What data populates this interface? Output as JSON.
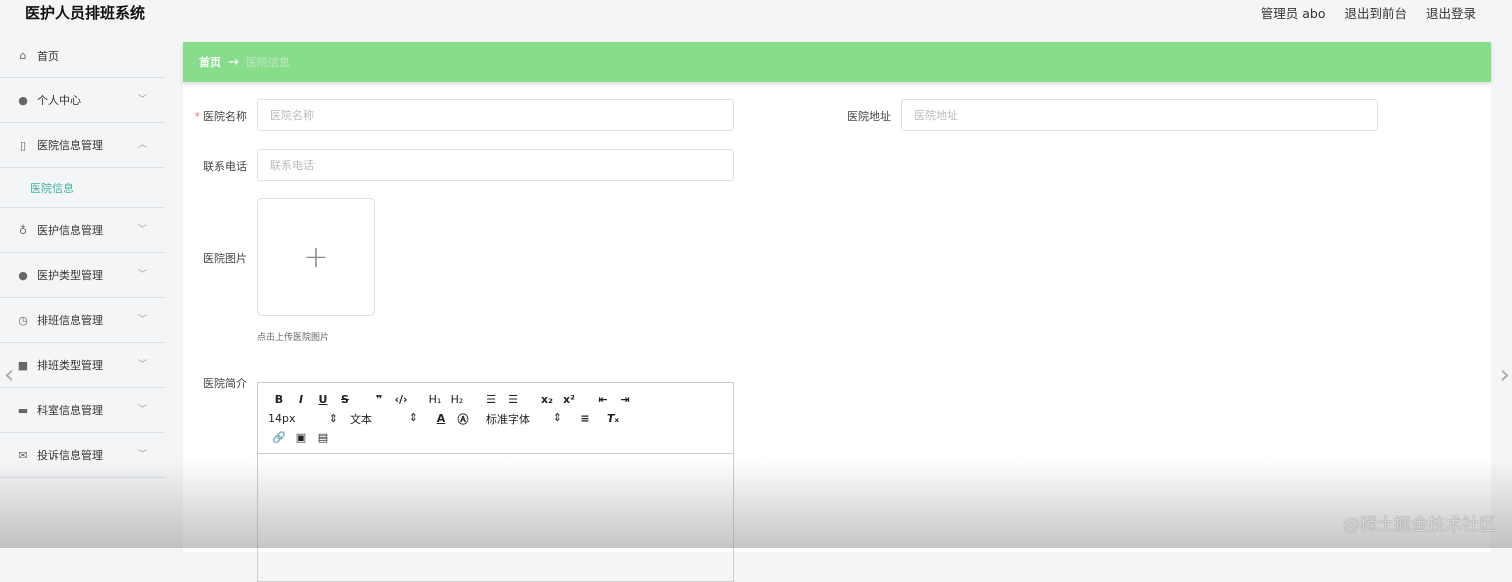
{
  "app": {
    "title": "医护人员排班系统"
  },
  "header": {
    "user": "管理员 abo",
    "to_front": "退出到前台",
    "logout": "退出登录"
  },
  "sidebar": {
    "items": [
      {
        "label": "首页",
        "icon": "home-icon"
      },
      {
        "label": "个人中心",
        "icon": "user-icon"
      },
      {
        "label": "医院信息管理",
        "icon": "mic-icon",
        "expanded": true,
        "sub": "医院信息"
      },
      {
        "label": "医护信息管理",
        "icon": "microphone-icon"
      },
      {
        "label": "医护类型管理",
        "icon": "bulb-icon"
      },
      {
        "label": "排班信息管理",
        "icon": "clock-icon"
      },
      {
        "label": "排班类型管理",
        "icon": "tag-icon"
      },
      {
        "label": "科室信息管理",
        "icon": "chat-icon"
      },
      {
        "label": "投诉信息管理",
        "icon": "mail-icon"
      }
    ]
  },
  "breadcrumb": {
    "home": "首页",
    "arrow": "→",
    "current": "医院信息"
  },
  "form": {
    "name_label": "医院名称",
    "name_placeholder": "医院名称",
    "address_label": "医院地址",
    "address_placeholder": "医院地址",
    "phone_label": "联系电话",
    "phone_placeholder": "联系电话",
    "image_label": "医院图片",
    "upload_plus": "+",
    "image_hint": "点击上传医院图片",
    "intro_label": "医院简介"
  },
  "editor": {
    "size": "14px",
    "block": "文本",
    "font": "标准字体"
  },
  "watermark": "@稀土掘金技术社区",
  "colors": {
    "accent": "#88dd8c",
    "submenu": "#3fb3a2"
  }
}
